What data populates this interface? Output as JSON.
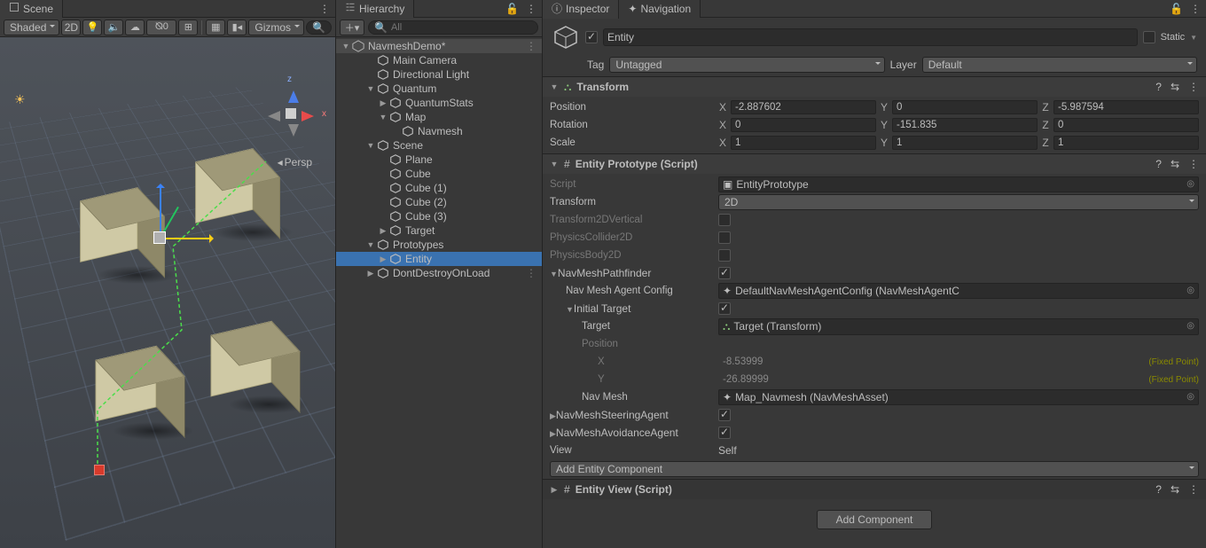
{
  "scene": {
    "tab": "Scene",
    "shading": "Shaded",
    "mode2d": "2D",
    "gizmos": "Gizmos",
    "persp": "Persp",
    "axis_x": "x",
    "axis_z": "z"
  },
  "hierarchy": {
    "tab": "Hierarchy",
    "searchPlaceholder": "All",
    "sceneName": "NavmeshDemo*",
    "nodes": [
      {
        "depth": 1,
        "label": "Main Camera",
        "fold": ""
      },
      {
        "depth": 1,
        "label": "Directional Light",
        "fold": ""
      },
      {
        "depth": 1,
        "label": "Quantum",
        "fold": "▼"
      },
      {
        "depth": 2,
        "label": "QuantumStats",
        "fold": "▶"
      },
      {
        "depth": 2,
        "label": "Map",
        "fold": "▼"
      },
      {
        "depth": 3,
        "label": "Navmesh",
        "fold": ""
      },
      {
        "depth": 1,
        "label": "Scene",
        "fold": "▼"
      },
      {
        "depth": 2,
        "label": "Plane",
        "fold": ""
      },
      {
        "depth": 2,
        "label": "Cube",
        "fold": ""
      },
      {
        "depth": 2,
        "label": "Cube (1)",
        "fold": ""
      },
      {
        "depth": 2,
        "label": "Cube (2)",
        "fold": ""
      },
      {
        "depth": 2,
        "label": "Cube (3)",
        "fold": ""
      },
      {
        "depth": 2,
        "label": "Target",
        "fold": "▶"
      },
      {
        "depth": 1,
        "label": "Prototypes",
        "fold": "▼"
      },
      {
        "depth": 2,
        "label": "Entity",
        "fold": "▶",
        "selected": true
      },
      {
        "depth": 1,
        "label": "DontDestroyOnLoad",
        "fold": "▶",
        "dim": true
      }
    ]
  },
  "inspector": {
    "tabMain": "Inspector",
    "tabNav": "Navigation",
    "name": "Entity",
    "static": "Static",
    "tagLabel": "Tag",
    "tagValue": "Untagged",
    "layerLabel": "Layer",
    "layerValue": "Default",
    "transform": {
      "title": "Transform",
      "position": {
        "label": "Position",
        "x": "-2.887602",
        "y": "0",
        "z": "-5.987594"
      },
      "rotation": {
        "label": "Rotation",
        "x": "0",
        "y": "-151.835",
        "z": "0"
      },
      "scale": {
        "label": "Scale",
        "x": "1",
        "y": "1",
        "z": "1"
      }
    },
    "proto": {
      "title": "Entity Prototype (Script)",
      "scriptLabel": "Script",
      "scriptValue": "EntityPrototype",
      "transformLabel": "Transform",
      "transformValue": "2D",
      "t2dv": "Transform2DVertical",
      "pc2d": "PhysicsCollider2D",
      "pb2d": "PhysicsBody2D",
      "pf": "NavMeshPathfinder",
      "cfgLabel": "Nav Mesh Agent Config",
      "cfgValue": "DefaultNavMeshAgentConfig (NavMeshAgentC",
      "initTgt": "Initial Target",
      "tgtLabel": "Target",
      "tgtValue": "Target (Transform)",
      "posLabel": "Position",
      "xLabel": "X",
      "xValue": "-8.53999",
      "yLabel": "Y",
      "yValue": "-26.89999",
      "fixed": "(Fixed Point)",
      "nmLabel": "Nav Mesh",
      "nmValue": "Map_Navmesh (NavMeshAsset)",
      "steer": "NavMeshSteeringAgent",
      "avoid": "NavMeshAvoidanceAgent",
      "viewLabel": "View",
      "viewValue": "Self",
      "addComp": "Add Entity Component"
    },
    "viewComp": "Entity View (Script)",
    "addComponent": "Add Component"
  }
}
